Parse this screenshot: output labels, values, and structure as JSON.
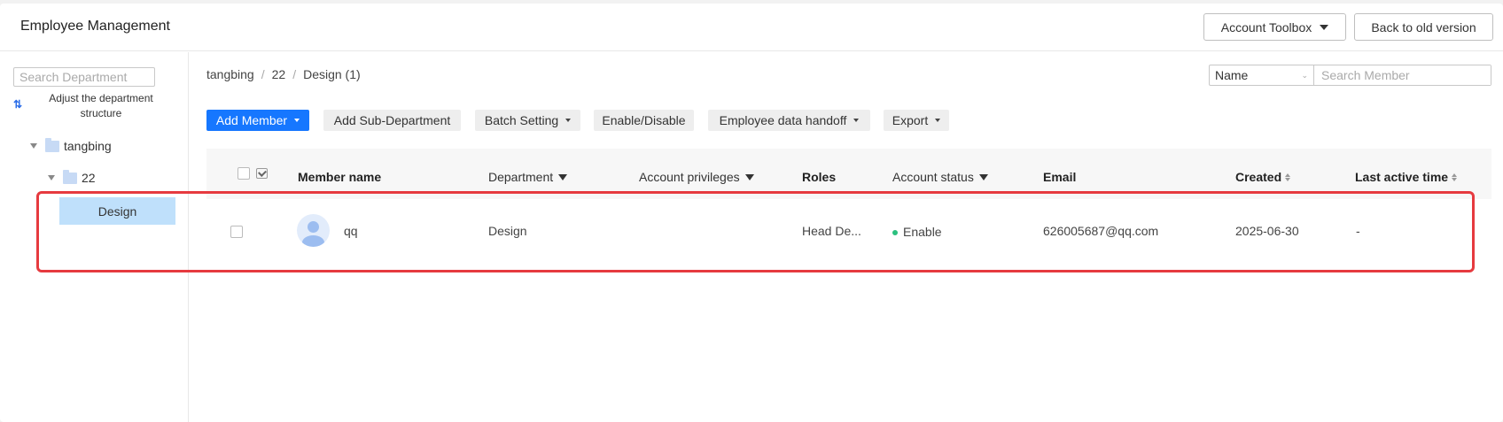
{
  "header": {
    "title": "Employee Management",
    "account_toolbox_label": "Account Toolbox",
    "back_old_version_label": "Back to old version"
  },
  "sidebar": {
    "search_placeholder": "Search Department",
    "adjust_label": "Adjust the department structure",
    "tree": {
      "root": "tangbing",
      "child": "22",
      "selected": "Design"
    }
  },
  "breadcrumb": [
    "tangbing",
    "22",
    "Design (1)"
  ],
  "search": {
    "field_select": "Name",
    "placeholder": "Search Member"
  },
  "toolbar": {
    "add_member": "Add Member",
    "add_sub_department": "Add Sub-Department",
    "batch_setting": "Batch Setting",
    "enable_disable": "Enable/Disable",
    "employee_data_handoff": "Employee data handoff",
    "export": "Export"
  },
  "table": {
    "columns": {
      "member_name": "Member name",
      "department": "Department",
      "account_privileges": "Account privileges",
      "roles": "Roles",
      "account_status": "Account status",
      "email": "Email",
      "created": "Created",
      "last_active_time": "Last active time"
    },
    "rows": [
      {
        "member_name": "qq",
        "department": "Design",
        "account_privileges": "",
        "roles": "Head De...",
        "account_status": "Enable",
        "email": "626005687@qq.com",
        "created": "2025-06-30",
        "last_active_time": "-"
      }
    ]
  },
  "colors": {
    "primary": "#1677ff",
    "selected_dept_bg": "#bfe0fb",
    "status_enable": "#2bc07f",
    "highlight_border": "#e63a3f"
  }
}
